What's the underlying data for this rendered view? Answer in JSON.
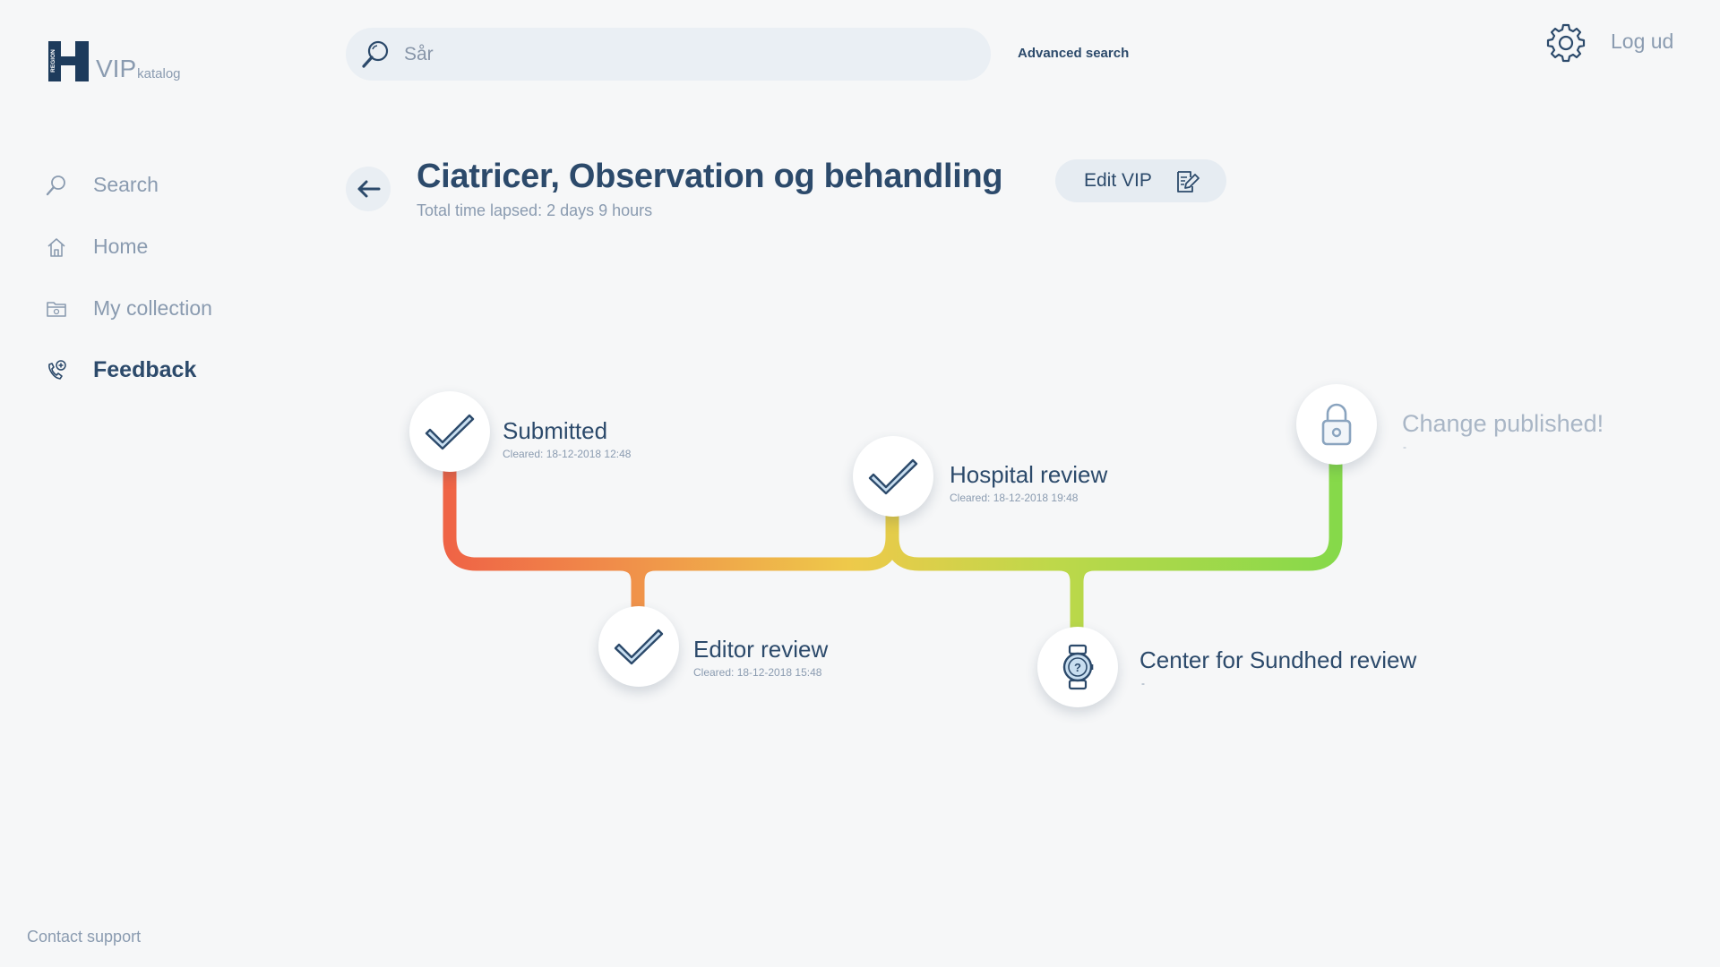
{
  "logo": {
    "badge_text": "REGION",
    "letter": "H",
    "title": "VIP",
    "subtitle": "katalog"
  },
  "search": {
    "placeholder": "Sår",
    "advanced_label": "Advanced search"
  },
  "header_actions": {
    "settings_icon": "gear-icon",
    "logout_label": "Log ud"
  },
  "sidebar": {
    "items": [
      {
        "label": "Search",
        "icon": "search-icon",
        "active": false
      },
      {
        "label": "Home",
        "icon": "home-icon",
        "active": false
      },
      {
        "label": "My collection",
        "icon": "collection-folder-icon",
        "active": false
      },
      {
        "label": "Feedback",
        "icon": "phone-plus-icon",
        "active": true
      }
    ],
    "contact_label": "Contact support"
  },
  "page": {
    "title": "Ciatricer, Observation og behandling",
    "time_lapsed": "Total time lapsed: 2 days 9 hours",
    "edit_label": "Edit VIP"
  },
  "timeline": {
    "gradient": [
      "#ef6446",
      "#f0904a",
      "#eec94a",
      "#bed84a",
      "#86d94a"
    ],
    "steps": [
      {
        "label": "Submitted",
        "sub": "Cleared:  18-12-2018  12:48",
        "status": "done",
        "icon": "checkmark-icon"
      },
      {
        "label": "Editor review",
        "sub": "Cleared:  18-12-2018  15:48",
        "status": "done",
        "icon": "checkmark-icon"
      },
      {
        "label": "Hospital review",
        "sub": "Cleared: 18-12-2018  19:48",
        "status": "done",
        "icon": "checkmark-icon"
      },
      {
        "label": "Center for Sundhed review",
        "sub": "-",
        "status": "pending",
        "icon": "watch-question-icon"
      },
      {
        "label": "Change published!",
        "sub": "-",
        "status": "locked",
        "icon": "lock-icon"
      }
    ]
  }
}
